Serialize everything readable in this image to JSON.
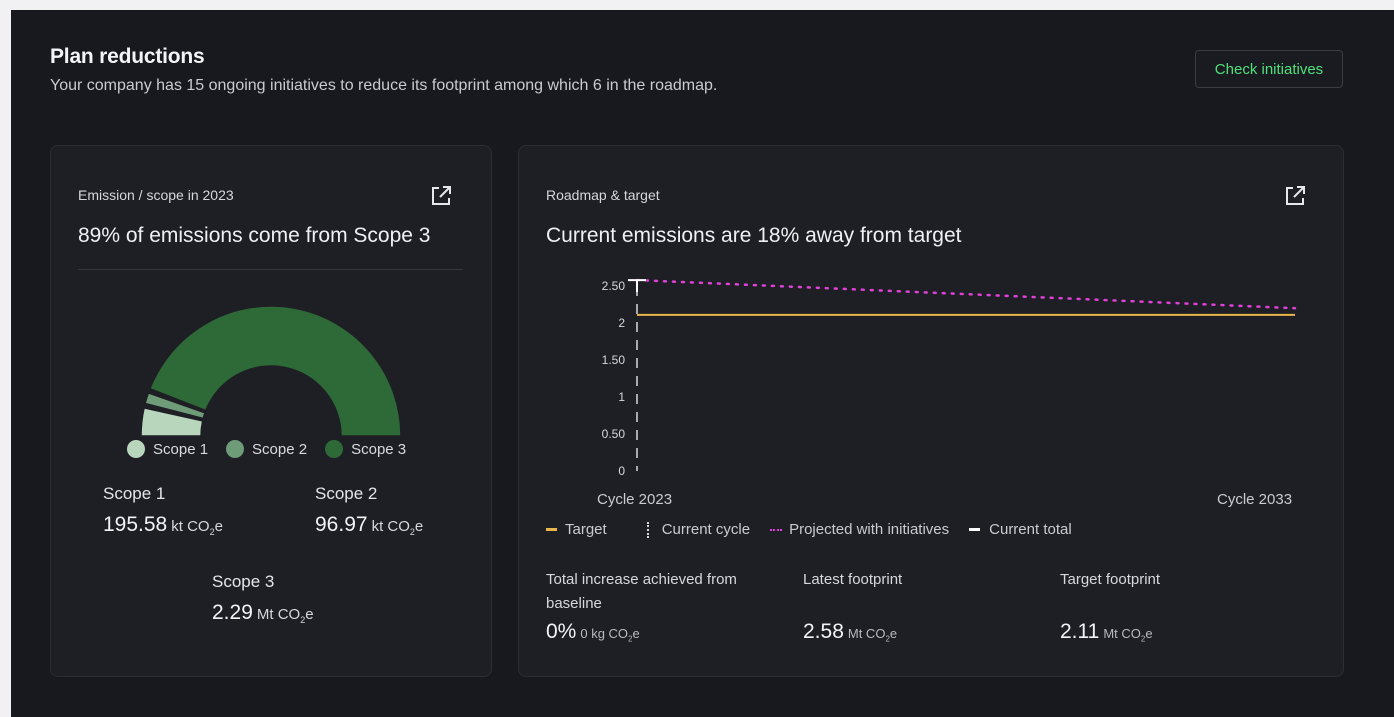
{
  "header": {
    "title": "Plan reductions",
    "subtitle": "Your company has 15 ongoing initiatives to reduce its footprint among which 6 in the roadmap.",
    "check_button": "Check initiatives",
    "accent_color": "#4fe07a"
  },
  "scope_card": {
    "label": "Emission / scope in 2023",
    "headline": "89% of emissions come from Scope 3",
    "icon": "external-link-icon",
    "legend": [
      {
        "name": "Scope 1",
        "color": "#b7d6bb"
      },
      {
        "name": "Scope 2",
        "color": "#6f9c78"
      },
      {
        "name": "Scope 3",
        "color": "#2e6a37"
      }
    ],
    "stats": {
      "scope1": {
        "label": "Scope 1",
        "value": "195.58",
        "unit": "kt CO",
        "unit_sub": "2",
        "unit_tail": "e"
      },
      "scope2": {
        "label": "Scope 2",
        "value": "96.97",
        "unit": "kt CO",
        "unit_sub": "2",
        "unit_tail": "e"
      },
      "scope3": {
        "label": "Scope 3",
        "value": "2.29",
        "unit": "Mt CO",
        "unit_sub": "2",
        "unit_tail": "e"
      }
    },
    "donut_shares": [
      0.075,
      0.038,
      0.887
    ]
  },
  "roadmap_card": {
    "label": "Roadmap & target",
    "headline": "Current emissions are 18% away from target",
    "icon": "external-link-icon",
    "cycle_start": "Cycle 2023",
    "cycle_end": "Cycle 2033",
    "legend": {
      "target": "Target",
      "current_cycle": "Current cycle",
      "projected": "Projected with initiatives",
      "current_total": "Current total"
    },
    "stats": {
      "increase": {
        "label": "Total increase achieved from baseline",
        "value": "0%",
        "unit": "0 kg CO",
        "unit_sub": "2",
        "unit_tail": "e"
      },
      "latest": {
        "label": "Latest footprint",
        "value": "2.58",
        "unit": "Mt CO",
        "unit_sub": "2",
        "unit_tail": "e"
      },
      "target": {
        "label": "Target footprint",
        "value": "2.11",
        "unit": "Mt CO",
        "unit_sub": "2",
        "unit_tail": "e"
      }
    }
  },
  "chart_data": {
    "type": "line",
    "yticks": [
      "0",
      "0.50",
      "1",
      "1.50",
      "2",
      "2.50"
    ],
    "ylim": [
      0,
      2.5
    ],
    "x": [
      2023,
      2033
    ],
    "series": [
      {
        "name": "Target",
        "color": "#e8b64a",
        "style": "solid",
        "x": [
          2023,
          2033
        ],
        "values": [
          2.11,
          2.11
        ]
      },
      {
        "name": "Projected with initiatives",
        "color": "#e040d8",
        "style": "dotted",
        "x": [
          2023,
          2033
        ],
        "values": [
          2.58,
          2.2
        ]
      },
      {
        "name": "Current total",
        "color": "#ffffff",
        "style": "marker",
        "x": [
          2023
        ],
        "values": [
          2.58
        ]
      }
    ],
    "current_cycle_x": 2023
  }
}
